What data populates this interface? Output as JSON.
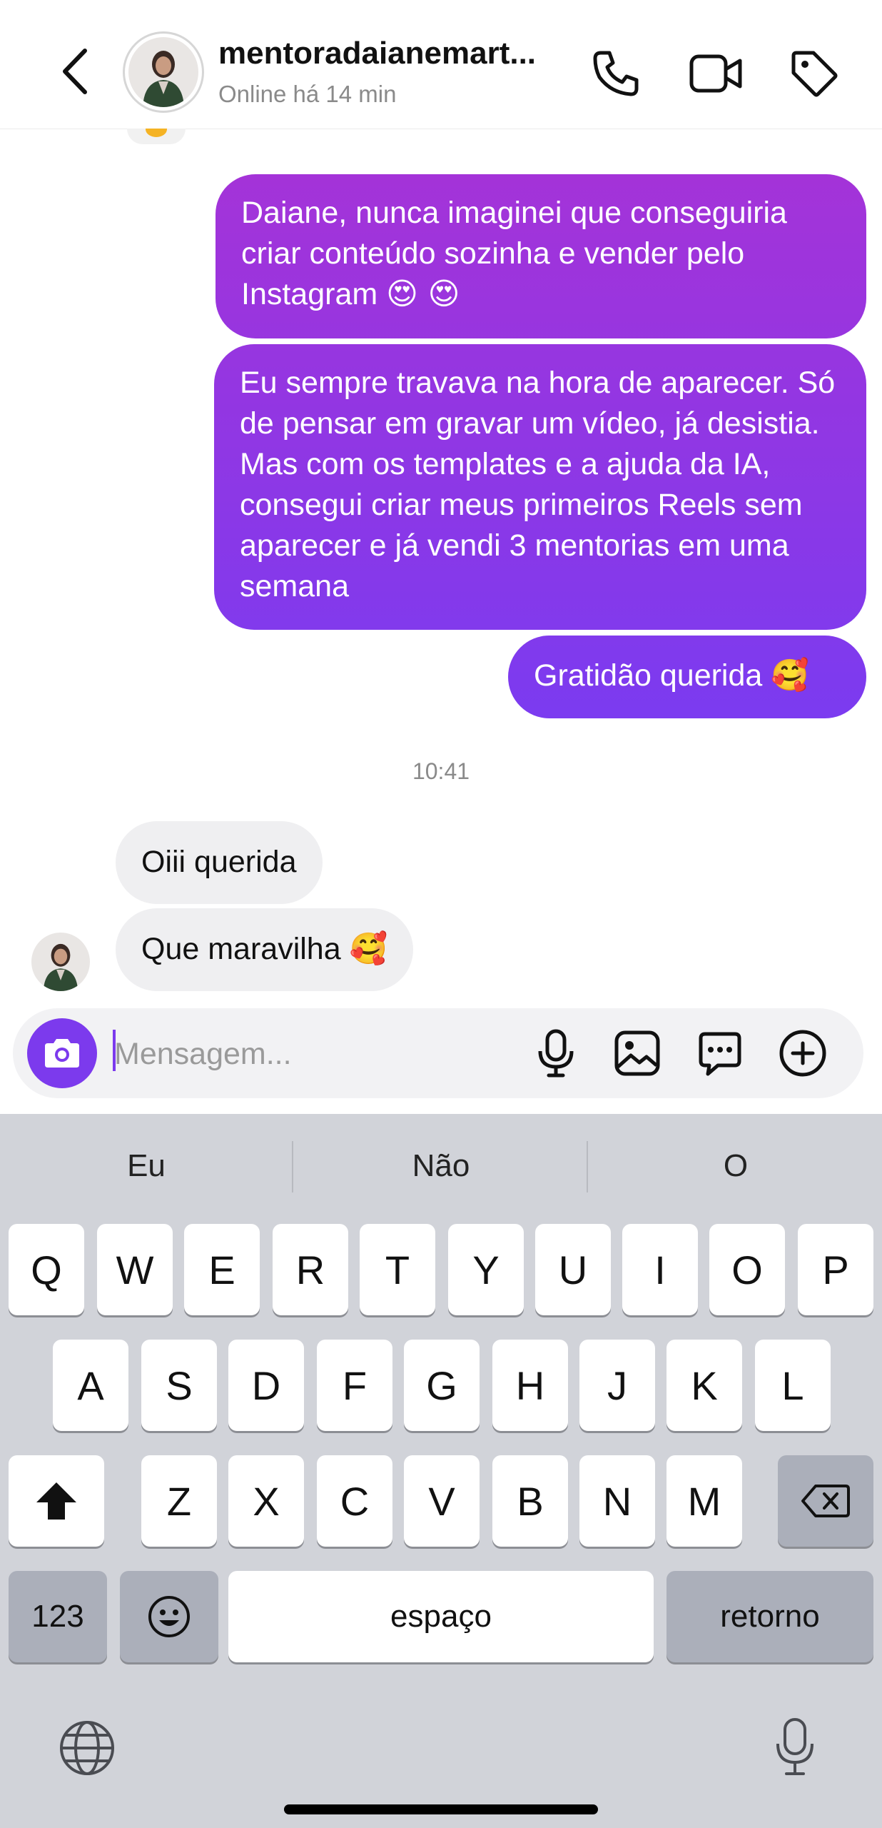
{
  "header": {
    "username": "mentoradaianemart...",
    "status": "Online há 14 min",
    "icons": [
      "chevron-left-icon",
      "phone-icon",
      "video-camera-icon",
      "tag-icon"
    ]
  },
  "messages": {
    "outgoing": [
      {
        "text": "Daiane, nunca imaginei que conseguiria criar conteúdo sozinha e vender pelo Instagram",
        "emoji": "😍 😍"
      },
      {
        "text": "Eu sempre travava na hora de aparecer. Só de pensar em gravar um vídeo, já desistia. Mas com os templates e a ajuda da IA, consegui criar meus primeiros Reels sem aparecer e já vendi 3 mentorias em uma semana"
      },
      {
        "text": "Gratidão querida",
        "emoji": "🥰"
      }
    ],
    "timestamp": "10:41",
    "incoming": [
      {
        "text": "Oiii querida"
      },
      {
        "text": "Que maravilha",
        "emoji": "🥰"
      }
    ]
  },
  "composer": {
    "placeholder": "Mensagem...",
    "icons": [
      "camera-icon",
      "microphone-icon",
      "image-icon",
      "sticker-chat-icon",
      "plus-circle-icon"
    ]
  },
  "keyboard": {
    "suggestions": [
      "Eu",
      "Não",
      "O"
    ],
    "row1": [
      "Q",
      "W",
      "E",
      "R",
      "T",
      "Y",
      "U",
      "I",
      "O",
      "P"
    ],
    "row2": [
      "A",
      "S",
      "D",
      "F",
      "G",
      "H",
      "J",
      "K",
      "L"
    ],
    "row3": [
      "Z",
      "X",
      "C",
      "V",
      "B",
      "N",
      "M"
    ],
    "numbers_label": "123",
    "space_label": "espaço",
    "return_label": "retorno"
  },
  "colors": {
    "bubble_gradient_top": "#a433d8",
    "bubble_gradient_bottom": "#7b3bf0",
    "incoming_bubble": "#efeff1",
    "accent": "#7c3aed",
    "keyboard_bg": "#d1d3d9"
  }
}
